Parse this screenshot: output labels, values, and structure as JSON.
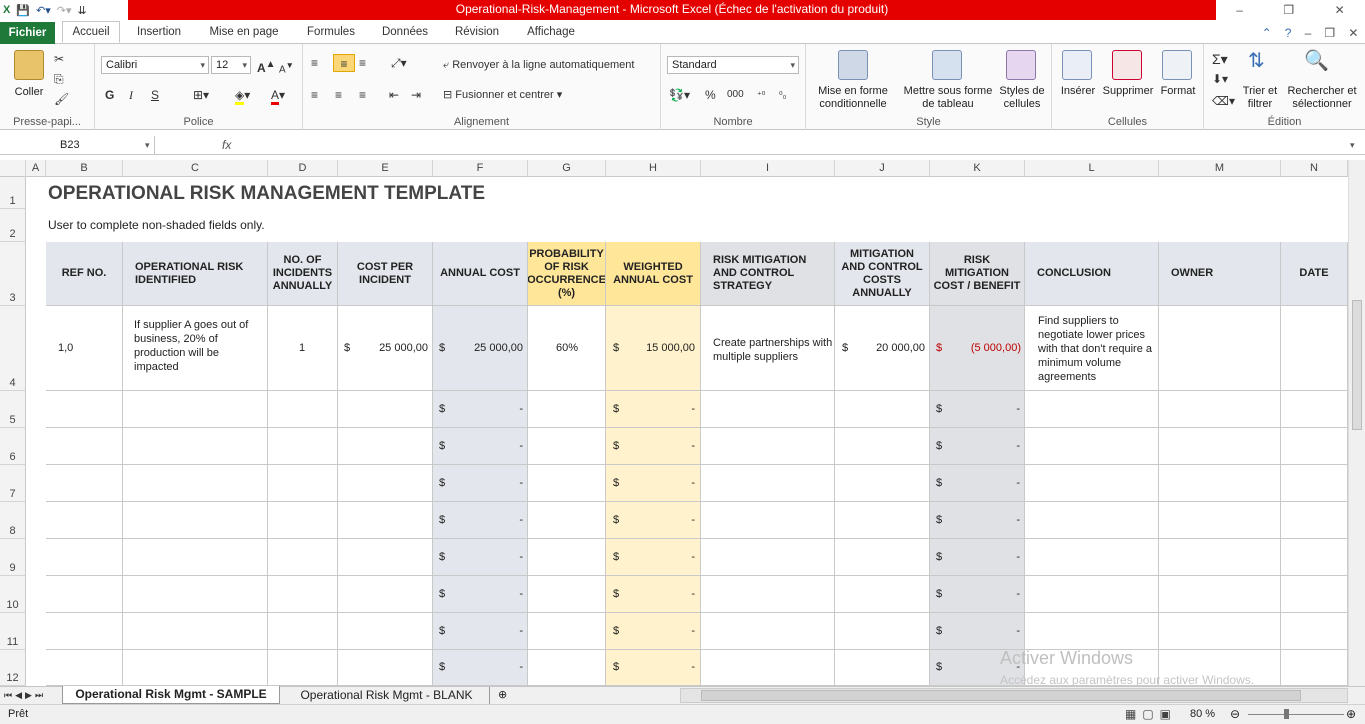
{
  "window": {
    "title": "Operational-Risk-Management  -  Microsoft Excel (Échec de l'activation du produit)"
  },
  "ribbon_tabs": [
    "Fichier",
    "Accueil",
    "Insertion",
    "Mise en page",
    "Formules",
    "Données",
    "Révision",
    "Affichage"
  ],
  "ribbon": {
    "coller": "Coller",
    "presse": "Presse-papi...",
    "font_name": "Calibri",
    "font_size": "12",
    "police": "Police",
    "bold": "G",
    "italic": "I",
    "underline": "S",
    "wrap": "Renvoyer à la ligne automatiquement",
    "merge": "Fusionner et centrer",
    "alignement": "Alignement",
    "number_format": "Standard",
    "nombre": "Nombre",
    "percent": "%",
    "thousands": "000",
    "mfc": "Mise en forme\nconditionnelle",
    "table": "Mettre sous forme\nde tableau",
    "styles": "Styles de\ncellules",
    "style": "Style",
    "inserer": "Insérer",
    "supprimer": "Supprimer",
    "format": "Format",
    "cellules": "Cellules",
    "trier": "Trier et\nfiltrer",
    "rechercher": "Rechercher et\nsélectionner",
    "edition": "Édition"
  },
  "formula_bar": {
    "cell_ref": "B23",
    "fx": "fx",
    "formula": ""
  },
  "columns": [
    "A",
    "B",
    "C",
    "D",
    "E",
    "F",
    "G",
    "H",
    "I",
    "J",
    "K",
    "L",
    "M",
    "N"
  ],
  "sheet": {
    "title": "OPERATIONAL RISK MANAGEMENT TEMPLATE",
    "subtitle": "User to complete non-shaded fields only.",
    "headers": [
      "REF NO.",
      "OPERATIONAL RISK IDENTIFIED",
      "NO. OF INCIDENTS ANNUALLY",
      "COST PER INCIDENT",
      "ANNUAL COST",
      "PROBABILITY OF RISK OCCURRENCE (%)",
      "WEIGHTED ANNUAL COST",
      "RISK MITIGATION AND CONTROL STRATEGY",
      "MITIGATION AND CONTROL COSTS ANNUALLY",
      "RISK MITIGATION COST / BENEFIT",
      "CONCLUSION",
      "OWNER",
      "DATE"
    ],
    "sample_row": {
      "ref": "1,0",
      "risk": "If supplier A goes out of business, 20% of production will be impacted",
      "incidents": "1",
      "cost_cur": "$",
      "cost": "25 000,00",
      "annual_cur": "$",
      "annual": "25 000,00",
      "prob": "60%",
      "weighted_cur": "$",
      "weighted": "15 000,00",
      "strategy": "Create partnerships with multiple suppliers",
      "mit_cur": "$",
      "mit": "20 000,00",
      "benefit_cur": "$",
      "benefit": "(5 000,00)",
      "conclusion": "Find suppliers to negotiate lower prices with that don't require a minimum volume agreements"
    },
    "empty_rows": [
      {
        "num": "5",
        "cur": "$",
        "dash": "-"
      },
      {
        "num": "6",
        "cur": "$",
        "dash": "-"
      },
      {
        "num": "7",
        "cur": "$",
        "dash": "-"
      },
      {
        "num": "8",
        "cur": "$",
        "dash": "-"
      },
      {
        "num": "9",
        "cur": "$",
        "dash": "-"
      },
      {
        "num": "10",
        "cur": "$",
        "dash": "-"
      },
      {
        "num": "11",
        "cur": "$",
        "dash": "-"
      },
      {
        "num": "12",
        "cur": "$",
        "dash": "-"
      }
    ],
    "row_numbers": [
      "1",
      "2",
      "3",
      "4"
    ]
  },
  "sheet_tabs": [
    "Operational Risk Mgmt - SAMPLE",
    "Operational Risk Mgmt - BLANK"
  ],
  "status": {
    "ready": "Prêt",
    "zoom": "80 %"
  },
  "watermark": {
    "line1": "Activer Windows",
    "line2": "Accédez aux paramètres pour activer Windows."
  },
  "colors": {
    "accent": "#1f7a3a",
    "title_red": "#e50000",
    "gold": "#ffe699",
    "cream": "#fff2cc",
    "gray": "#e3e6ec",
    "negative": "#c00000"
  }
}
